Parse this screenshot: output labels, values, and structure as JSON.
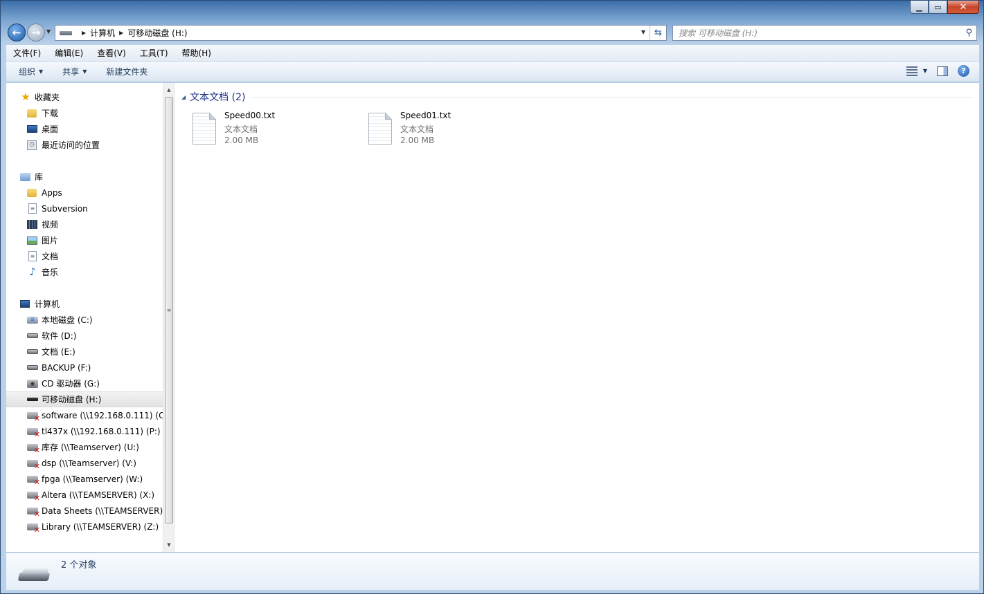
{
  "titlebar": {
    "minimize_icon": "minimize-icon",
    "maximize_icon": "maximize-icon",
    "close_icon": "close-icon"
  },
  "address": {
    "crumbs": [
      "计算机",
      "可移动磁盘 (H:)"
    ],
    "drive_icon": "usb-drive-icon"
  },
  "search": {
    "placeholder": "搜索 可移动磁盘 (H:)"
  },
  "menu": [
    "文件(F)",
    "编辑(E)",
    "查看(V)",
    "工具(T)",
    "帮助(H)"
  ],
  "toolbar": {
    "organize": "组织",
    "share": "共享",
    "new_folder": "新建文件夹"
  },
  "nav": {
    "favorites": {
      "title": "收藏夹",
      "items": [
        "下载",
        "桌面",
        "最近访问的位置"
      ]
    },
    "libraries": {
      "title": "库",
      "items": [
        "Apps",
        "Subversion",
        "视频",
        "图片",
        "文档",
        "音乐"
      ]
    },
    "computer": {
      "title": "计算机",
      "items": [
        "本地磁盘 (C:)",
        "软件 (D:)",
        "文档 (E:)",
        "BACKUP (F:)",
        "CD 驱动器 (G:)",
        "可移动磁盘 (H:)",
        "software (\\\\192.168.0.111) (O:",
        "tl437x (\\\\192.168.0.111) (P:)",
        "库存 (\\\\Teamserver) (U:)",
        "dsp (\\\\Teamserver) (V:)",
        "fpga (\\\\Teamserver) (W:)",
        "Altera (\\\\TEAMSERVER) (X:)",
        "Data Sheets (\\\\TEAMSERVER)",
        "Library (\\\\TEAMSERVER) (Z:)"
      ],
      "selected_index": 5
    }
  },
  "content": {
    "group_title": "文本文档 (2)",
    "files": [
      {
        "name": "Speed00.txt",
        "type": "文本文档",
        "size": "2.00 MB"
      },
      {
        "name": "Speed01.txt",
        "type": "文本文档",
        "size": "2.00 MB"
      }
    ]
  },
  "status": {
    "count": "2 个对象"
  }
}
